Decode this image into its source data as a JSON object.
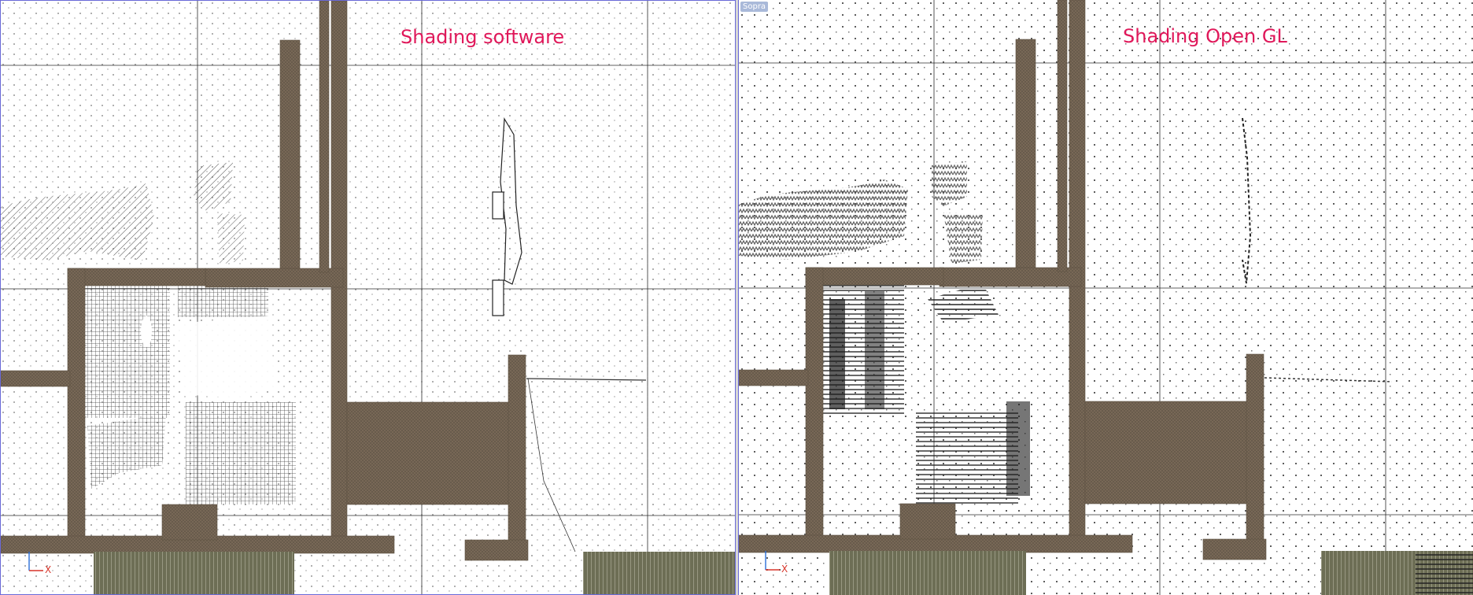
{
  "viewports": {
    "left": {
      "title": "Shading software",
      "axis": {
        "x_label": "X"
      }
    },
    "right": {
      "title": "Shading Open GL",
      "view_label": "Sopra",
      "axis": {
        "x_label": "X"
      }
    }
  },
  "colors": {
    "title": "#e0185a",
    "wall": "#7a6a58",
    "wall_dark": "#5e5244",
    "foundation": "#6d6e55",
    "grid": "#2b2b2b",
    "viewport_border": "#6a6ad8",
    "axis_x": "#d8352a",
    "axis_y": "#2a6fd8"
  }
}
